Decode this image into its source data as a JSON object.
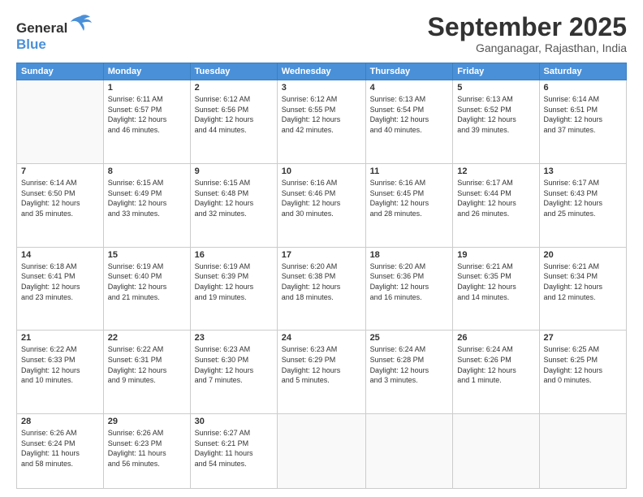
{
  "logo": {
    "line1": "General",
    "line2": "Blue"
  },
  "title": "September 2025",
  "subtitle": "Ganganagar, Rajasthan, India",
  "weekdays": [
    "Sunday",
    "Monday",
    "Tuesday",
    "Wednesday",
    "Thursday",
    "Friday",
    "Saturday"
  ],
  "weeks": [
    [
      {
        "day": "",
        "info": ""
      },
      {
        "day": "1",
        "info": "Sunrise: 6:11 AM\nSunset: 6:57 PM\nDaylight: 12 hours\nand 46 minutes."
      },
      {
        "day": "2",
        "info": "Sunrise: 6:12 AM\nSunset: 6:56 PM\nDaylight: 12 hours\nand 44 minutes."
      },
      {
        "day": "3",
        "info": "Sunrise: 6:12 AM\nSunset: 6:55 PM\nDaylight: 12 hours\nand 42 minutes."
      },
      {
        "day": "4",
        "info": "Sunrise: 6:13 AM\nSunset: 6:54 PM\nDaylight: 12 hours\nand 40 minutes."
      },
      {
        "day": "5",
        "info": "Sunrise: 6:13 AM\nSunset: 6:52 PM\nDaylight: 12 hours\nand 39 minutes."
      },
      {
        "day": "6",
        "info": "Sunrise: 6:14 AM\nSunset: 6:51 PM\nDaylight: 12 hours\nand 37 minutes."
      }
    ],
    [
      {
        "day": "7",
        "info": "Sunrise: 6:14 AM\nSunset: 6:50 PM\nDaylight: 12 hours\nand 35 minutes."
      },
      {
        "day": "8",
        "info": "Sunrise: 6:15 AM\nSunset: 6:49 PM\nDaylight: 12 hours\nand 33 minutes."
      },
      {
        "day": "9",
        "info": "Sunrise: 6:15 AM\nSunset: 6:48 PM\nDaylight: 12 hours\nand 32 minutes."
      },
      {
        "day": "10",
        "info": "Sunrise: 6:16 AM\nSunset: 6:46 PM\nDaylight: 12 hours\nand 30 minutes."
      },
      {
        "day": "11",
        "info": "Sunrise: 6:16 AM\nSunset: 6:45 PM\nDaylight: 12 hours\nand 28 minutes."
      },
      {
        "day": "12",
        "info": "Sunrise: 6:17 AM\nSunset: 6:44 PM\nDaylight: 12 hours\nand 26 minutes."
      },
      {
        "day": "13",
        "info": "Sunrise: 6:17 AM\nSunset: 6:43 PM\nDaylight: 12 hours\nand 25 minutes."
      }
    ],
    [
      {
        "day": "14",
        "info": "Sunrise: 6:18 AM\nSunset: 6:41 PM\nDaylight: 12 hours\nand 23 minutes."
      },
      {
        "day": "15",
        "info": "Sunrise: 6:19 AM\nSunset: 6:40 PM\nDaylight: 12 hours\nand 21 minutes."
      },
      {
        "day": "16",
        "info": "Sunrise: 6:19 AM\nSunset: 6:39 PM\nDaylight: 12 hours\nand 19 minutes."
      },
      {
        "day": "17",
        "info": "Sunrise: 6:20 AM\nSunset: 6:38 PM\nDaylight: 12 hours\nand 18 minutes."
      },
      {
        "day": "18",
        "info": "Sunrise: 6:20 AM\nSunset: 6:36 PM\nDaylight: 12 hours\nand 16 minutes."
      },
      {
        "day": "19",
        "info": "Sunrise: 6:21 AM\nSunset: 6:35 PM\nDaylight: 12 hours\nand 14 minutes."
      },
      {
        "day": "20",
        "info": "Sunrise: 6:21 AM\nSunset: 6:34 PM\nDaylight: 12 hours\nand 12 minutes."
      }
    ],
    [
      {
        "day": "21",
        "info": "Sunrise: 6:22 AM\nSunset: 6:33 PM\nDaylight: 12 hours\nand 10 minutes."
      },
      {
        "day": "22",
        "info": "Sunrise: 6:22 AM\nSunset: 6:31 PM\nDaylight: 12 hours\nand 9 minutes."
      },
      {
        "day": "23",
        "info": "Sunrise: 6:23 AM\nSunset: 6:30 PM\nDaylight: 12 hours\nand 7 minutes."
      },
      {
        "day": "24",
        "info": "Sunrise: 6:23 AM\nSunset: 6:29 PM\nDaylight: 12 hours\nand 5 minutes."
      },
      {
        "day": "25",
        "info": "Sunrise: 6:24 AM\nSunset: 6:28 PM\nDaylight: 12 hours\nand 3 minutes."
      },
      {
        "day": "26",
        "info": "Sunrise: 6:24 AM\nSunset: 6:26 PM\nDaylight: 12 hours\nand 1 minute."
      },
      {
        "day": "27",
        "info": "Sunrise: 6:25 AM\nSunset: 6:25 PM\nDaylight: 12 hours\nand 0 minutes."
      }
    ],
    [
      {
        "day": "28",
        "info": "Sunrise: 6:26 AM\nSunset: 6:24 PM\nDaylight: 11 hours\nand 58 minutes."
      },
      {
        "day": "29",
        "info": "Sunrise: 6:26 AM\nSunset: 6:23 PM\nDaylight: 11 hours\nand 56 minutes."
      },
      {
        "day": "30",
        "info": "Sunrise: 6:27 AM\nSunset: 6:21 PM\nDaylight: 11 hours\nand 54 minutes."
      },
      {
        "day": "",
        "info": ""
      },
      {
        "day": "",
        "info": ""
      },
      {
        "day": "",
        "info": ""
      },
      {
        "day": "",
        "info": ""
      }
    ]
  ]
}
